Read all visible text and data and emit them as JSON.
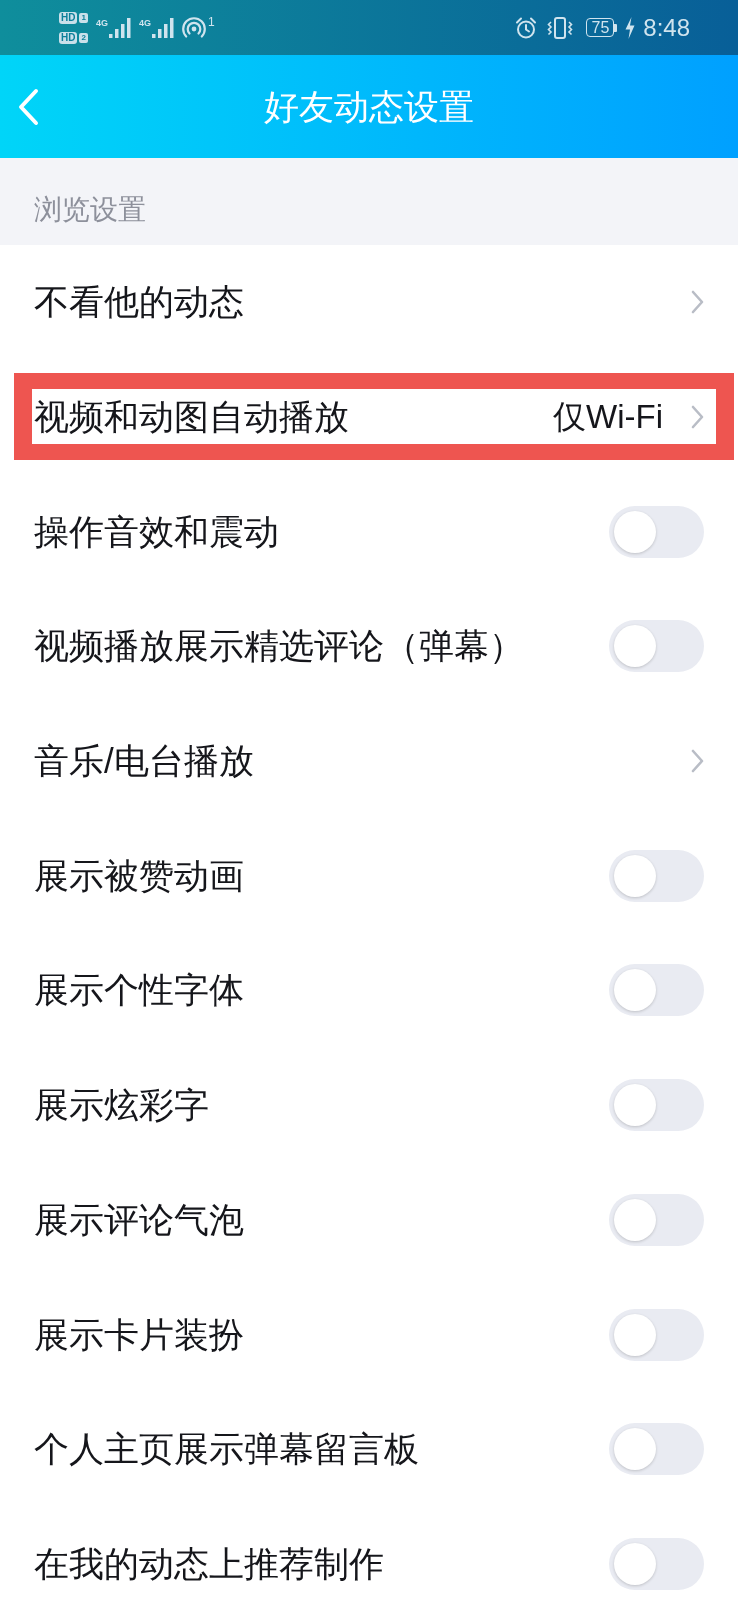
{
  "status_bar": {
    "sims": [
      {
        "badge": "HD",
        "slot": "1"
      },
      {
        "badge": "HD",
        "slot": "2"
      }
    ],
    "networks": [
      {
        "type": "4G"
      },
      {
        "type": "4G"
      }
    ],
    "hotspot_count": "1",
    "battery": "75",
    "charging": true,
    "time": "8:48"
  },
  "header": {
    "title": "好友动态设置"
  },
  "section": {
    "title": "浏览设置"
  },
  "rows": [
    {
      "label": "不看他的动态",
      "kind": "link",
      "highlighted": false
    },
    {
      "label": "视频和动图自动播放",
      "kind": "link",
      "value": "仅Wi-Fi",
      "highlighted": true
    },
    {
      "label": "操作音效和震动",
      "kind": "toggle",
      "on": false,
      "highlighted": false
    },
    {
      "label": "视频播放展示精选评论（弹幕）",
      "kind": "toggle",
      "on": false,
      "highlighted": false
    },
    {
      "label": "音乐/电台播放",
      "kind": "link",
      "highlighted": false
    },
    {
      "label": "展示被赞动画",
      "kind": "toggle",
      "on": false,
      "highlighted": false
    },
    {
      "label": "展示个性字体",
      "kind": "toggle",
      "on": false,
      "highlighted": false
    },
    {
      "label": "展示炫彩字",
      "kind": "toggle",
      "on": false,
      "highlighted": false
    },
    {
      "label": "展示评论气泡",
      "kind": "toggle",
      "on": false,
      "highlighted": false
    },
    {
      "label": "展示卡片装扮",
      "kind": "toggle",
      "on": false,
      "highlighted": false
    },
    {
      "label": "个人主页展示弹幕留言板",
      "kind": "toggle",
      "on": false,
      "highlighted": false
    },
    {
      "label": "在我的动态上推荐制作",
      "kind": "toggle",
      "on": false,
      "highlighted": false
    }
  ]
}
